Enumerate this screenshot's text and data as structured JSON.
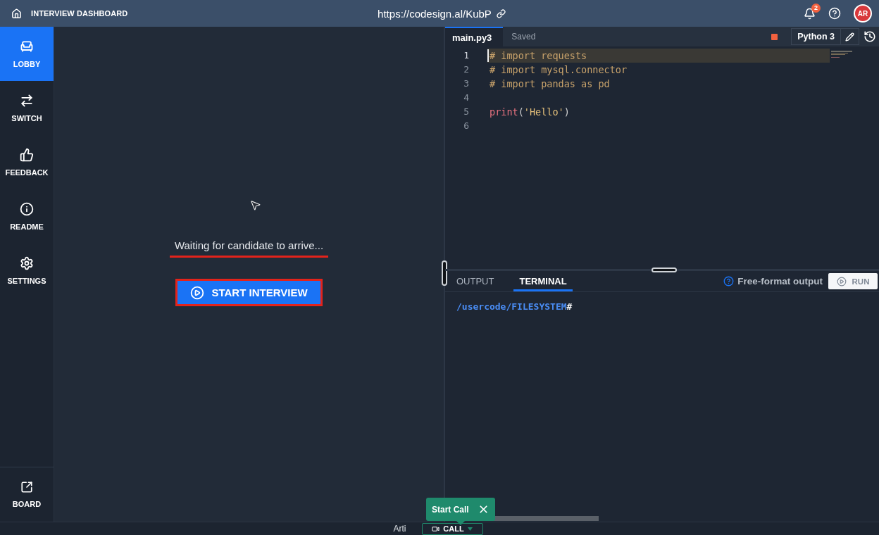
{
  "top_bar": {
    "title": "INTERVIEW DASHBOARD",
    "url": "https://codesign.al/KubP",
    "notification_count": "2",
    "avatar_initials": "AR"
  },
  "sidebar": {
    "items": [
      {
        "label": "LOBBY",
        "selected": true
      },
      {
        "label": "SWITCH",
        "selected": false
      },
      {
        "label": "FEEDBACK",
        "selected": false
      },
      {
        "label": "README",
        "selected": false
      },
      {
        "label": "SETTINGS",
        "selected": false
      }
    ],
    "footer_item": {
      "label": "BOARD",
      "selected": false
    }
  },
  "lobby": {
    "message": {
      "text": "Waiting for candidate to arrive...",
      "highlighted": true
    },
    "start_button": {
      "label": "START INTERVIEW",
      "highlighted": true
    }
  },
  "editor": {
    "tabs": [
      {
        "label": "main.py3",
        "selected": true
      }
    ],
    "save_status": "Saved",
    "language": "Python 3",
    "lines": [
      {
        "number": "1",
        "current": true,
        "tokens": [
          {
            "text": "# import requests",
            "kind": "comment"
          }
        ]
      },
      {
        "number": "2",
        "current": false,
        "tokens": [
          {
            "text": "# import mysql.connector",
            "kind": "comment"
          }
        ]
      },
      {
        "number": "3",
        "current": false,
        "tokens": [
          {
            "text": "# import pandas as pd",
            "kind": "comment"
          }
        ]
      },
      {
        "number": "4",
        "current": false
      },
      {
        "number": "5",
        "current": false,
        "tokens": [
          {
            "text": "print",
            "kind": "function"
          },
          {
            "text": "(",
            "kind": "punctuation"
          },
          {
            "text": "'Hello'",
            "kind": "string"
          },
          {
            "text": ")",
            "kind": "punctuation"
          }
        ]
      },
      {
        "number": "6",
        "current": false
      }
    ]
  },
  "output": {
    "tabs": [
      {
        "label": "OUTPUT",
        "selected": false
      },
      {
        "label": "TERMINAL",
        "selected": true
      }
    ],
    "hint": "Free-format output",
    "run_button": {
      "label": "RUN",
      "disabled": true
    },
    "terminal": {
      "path": "/usercode/FILESYSTEM",
      "symbol": "#"
    }
  },
  "tooltip": {
    "text": "Start Call"
  },
  "bottom_bar": {
    "name": "Arti",
    "call_button": {
      "label": "CALL"
    }
  }
}
